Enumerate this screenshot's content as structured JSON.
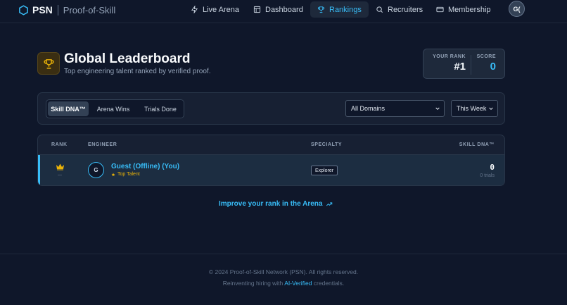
{
  "nav": {
    "brand": "PSN",
    "brand_sub": "Proof-of-Skill",
    "items": [
      {
        "label": "Live Arena",
        "icon": "bolt-icon"
      },
      {
        "label": "Dashboard",
        "icon": "layout-icon"
      },
      {
        "label": "Rankings",
        "icon": "trophy-icon",
        "active": true
      },
      {
        "label": "Recruiters",
        "icon": "search-icon"
      },
      {
        "label": "Membership",
        "icon": "card-icon"
      }
    ],
    "avatar": "G("
  },
  "header": {
    "title": "Global Leaderboard",
    "subtitle": "Top engineering talent ranked by verified proof."
  },
  "stats": {
    "rank_label": "YOUR RANK",
    "rank_value": "#1",
    "score_label": "SCORE",
    "score_value": "0"
  },
  "filters": {
    "tabs": [
      "Skill DNA™",
      "Arena Wins",
      "Trials Done"
    ],
    "active_tab": "Skill DNA™",
    "domain_select": "All Domains",
    "period_select": "This Week"
  },
  "table": {
    "headers": {
      "rank": "RANK",
      "engineer": "ENGINEER",
      "specialty": "SPECIALTY",
      "skill": "SKILL DNA™"
    },
    "rows": [
      {
        "avatar": "G",
        "name": "Guest (Offline) (You)",
        "tag": "Top Talent",
        "specialty": "Explorer",
        "skill_value": "0",
        "trials": "0 trials"
      }
    ]
  },
  "improve_link": "Improve your rank in the Arena",
  "footer": {
    "line1": "© 2024 Proof-of-Skill Network (PSN). All rights reserved.",
    "line2_pre": "Reinventing hiring with",
    "line2_highlight": "AI-Verified",
    "line2_post": "credentials."
  },
  "colors": {
    "background": "#0f172a",
    "accent": "#38bdf8",
    "gold": "#eab308"
  }
}
